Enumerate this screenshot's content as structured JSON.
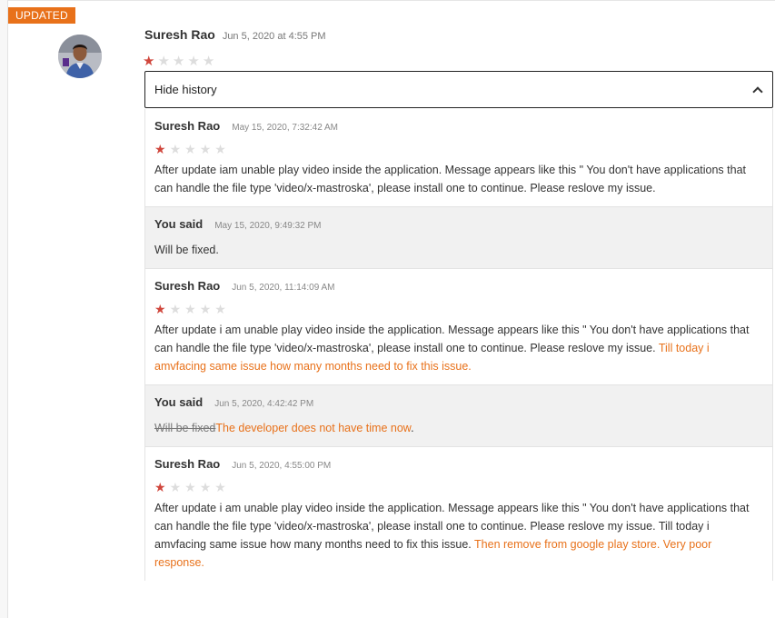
{
  "badge": "UPDATED",
  "review": {
    "author": "Suresh Rao",
    "date": "Jun 5, 2020 at 4:55 PM",
    "rating": 1
  },
  "history_toggle": {
    "label": "Hide history"
  },
  "colors": {
    "accent": "#e8711a",
    "star_on": "#d0463c",
    "star_off": "#dddddd",
    "reply_bg": "#f1f1f1"
  },
  "history": [
    {
      "type": "review",
      "author": "Suresh Rao",
      "date": "May 15, 2020, 7:32:42 AM",
      "rating": 1,
      "text": "After update iam unable play video inside the application. Message appears like this \" You don't have applications that can handle the file type 'video/x-mastroska', please install one to continue. Please reslove my issue.",
      "added": ""
    },
    {
      "type": "reply",
      "author": "You said",
      "date": "May 15, 2020, 9:49:32 PM",
      "text": "Will be fixed.",
      "removed": "",
      "added": ""
    },
    {
      "type": "review",
      "author": "Suresh Rao",
      "date": "Jun 5, 2020, 11:14:09 AM",
      "rating": 1,
      "text": "After update i am unable play video inside the application. Message appears like this \" You don't have applications that can handle the file type 'video/x-mastroska', please install one to continue. Please reslove my issue. ",
      "added": "Till today i amvfacing same issue how many months need to fix this issue."
    },
    {
      "type": "reply",
      "author": "You said",
      "date": "Jun 5, 2020, 4:42:42 PM",
      "text": "",
      "removed": "Will be fixed",
      "added": "The developer does not have time now",
      "tail": "."
    },
    {
      "type": "review",
      "author": "Suresh Rao",
      "date": "Jun 5, 2020, 4:55:00 PM",
      "rating": 1,
      "text": "After update i am unable play video inside the application. Message appears like this \" You don't have applications that can handle the file type 'video/x-mastroska', please install one to continue. Please reslove my issue. Till today i amvfacing same issue how many months need to fix this issue. ",
      "added": "Then remove from google play store. Very poor response."
    }
  ]
}
